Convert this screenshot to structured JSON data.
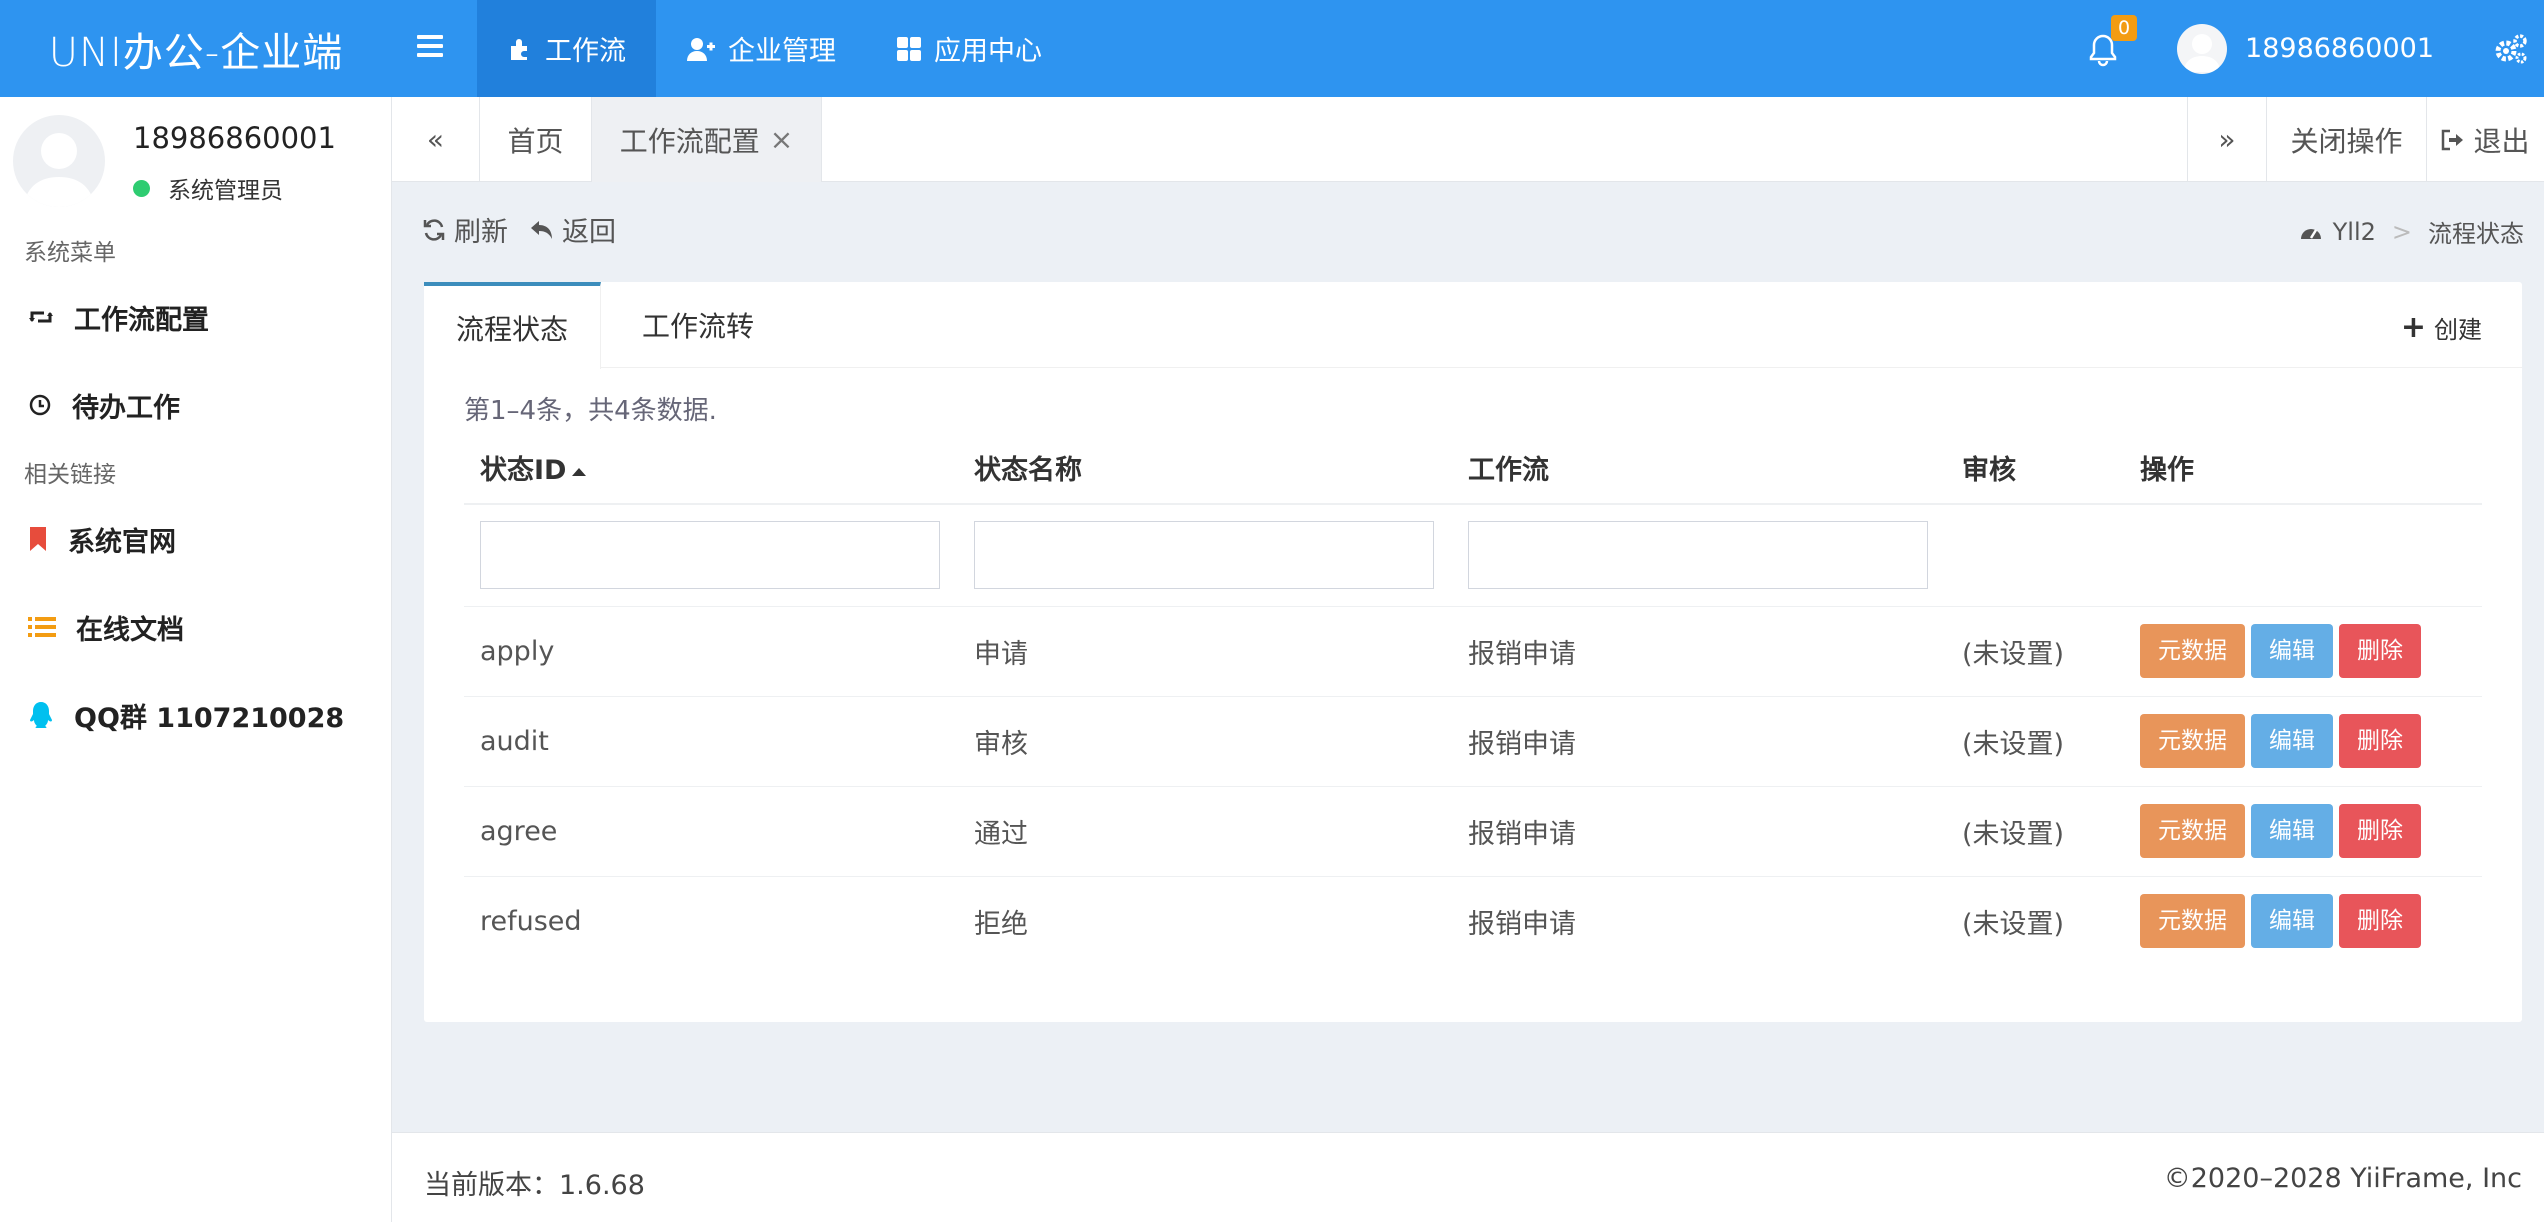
{
  "app": {
    "logo": "UNI办公-企业端"
  },
  "topnav": [
    {
      "label": "工作流",
      "icon": "puzzle-icon",
      "active": true
    },
    {
      "label": "企业管理",
      "icon": "user-plus-icon",
      "active": false
    },
    {
      "label": "应用中心",
      "icon": "grid-icon",
      "active": false
    }
  ],
  "top_right": {
    "notification_count": "0",
    "username": "18986860001"
  },
  "sidebar": {
    "username": "18986860001",
    "role": "系统管理员",
    "section1": "系统菜单",
    "section1_items": [
      {
        "label": "工作流配置",
        "icon": "retweet-icon"
      },
      {
        "label": "待办工作",
        "icon": "clock-icon"
      }
    ],
    "section2": "相关链接",
    "section2_items": [
      {
        "label": "系统官网",
        "icon": "bookmark-icon",
        "color": "#e74c3c"
      },
      {
        "label": "在线文档",
        "icon": "list-icon",
        "color": "#f39c12"
      },
      {
        "label": "QQ群 1107210028",
        "icon": "qq-icon",
        "color": "#00c0ef"
      }
    ]
  },
  "tabs": {
    "prev": "«",
    "home": "首页",
    "current": "工作流配置",
    "current_close": "×",
    "next": "»",
    "close_ops": "关闭操作",
    "logout": "退出"
  },
  "toolbar": {
    "refresh": "刷新",
    "back": "返回"
  },
  "breadcrumb": {
    "root": "Yll2",
    "sep": ">",
    "current": "流程状态"
  },
  "card": {
    "tab_active": "流程状态",
    "tab_other": "工作流转",
    "create": "创建",
    "summary": "第1–4条，共4条数据.",
    "columns": [
      "状态ID",
      "状态名称",
      "工作流",
      "审核",
      "操作"
    ],
    "rows": [
      {
        "id": "apply",
        "name": "申请",
        "workflow": "报销申请",
        "audit": "(未设置)"
      },
      {
        "id": "audit",
        "name": "审核",
        "workflow": "报销申请",
        "audit": "(未设置)"
      },
      {
        "id": "agree",
        "name": "通过",
        "workflow": "报销申请",
        "audit": "(未设置)"
      },
      {
        "id": "refused",
        "name": "拒绝",
        "workflow": "报销申请",
        "audit": "(未设置)"
      }
    ],
    "actions": {
      "meta": "元数据",
      "edit": "编辑",
      "delete": "删除"
    }
  },
  "footer": {
    "version": "当前版本：1.6.68",
    "copyright": "©2020–2028 YiiFrame, Inc"
  },
  "colors": {
    "primary": "#2e94f0",
    "warning": "#e8955a",
    "info": "#64aee6",
    "danger": "#e8555a",
    "online": "#2ecc71"
  }
}
